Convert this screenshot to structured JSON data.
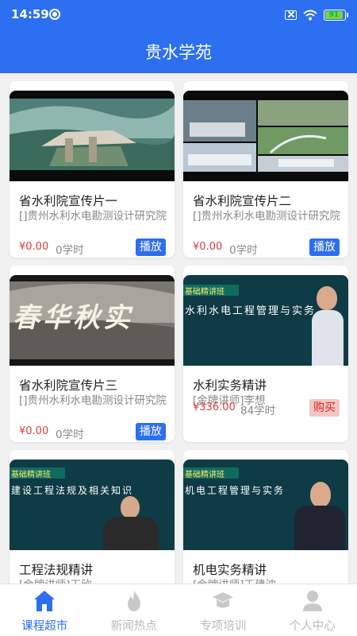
{
  "status": {
    "time": "14:59",
    "battery": "91"
  },
  "header": {
    "title": "贵水学苑"
  },
  "courses": [
    {
      "title": "省水利院宣传片一",
      "org": "[]贵州水利水电勘测设计研究院",
      "price": "¥0.00",
      "hours": "0学时",
      "action": "播放",
      "action_type": "play"
    },
    {
      "title": "省水利院宣传片二",
      "org": "[]贵州水利水电勘测设计研究院",
      "price": "¥0.00",
      "hours": "0学时",
      "action": "播放",
      "action_type": "play"
    },
    {
      "title": "省水利院宣传片三",
      "org": "[]贵州水利水电勘测设计研究院",
      "price": "¥0.00",
      "hours": "0学时",
      "action": "播放",
      "action_type": "play",
      "thumb_text": "春华秋实"
    },
    {
      "title": "水利实务精讲",
      "org": "[金牌讲师]李想",
      "price": "¥336.00",
      "hours": "84学时",
      "action": "购买",
      "action_type": "buy",
      "thumb_tag": "基础精讲班",
      "thumb_text": "水利水电工程管理与实务"
    },
    {
      "title": "工程法规精讲",
      "org": "[金牌讲师]王欣",
      "thumb_tag": "基础精讲班",
      "thumb_text": "建设工程法规及相关知识"
    },
    {
      "title": "机电实务精讲",
      "org": "[金牌讲师]王建波",
      "thumb_tag": "基础精讲班",
      "thumb_text": "机电工程管理与实务"
    }
  ],
  "nav": [
    {
      "label": "课程超市",
      "icon": "home-icon",
      "active": true
    },
    {
      "label": "新闻热点",
      "icon": "fire-icon",
      "active": false
    },
    {
      "label": "专项培训",
      "icon": "graduation-cap-icon",
      "active": false
    },
    {
      "label": "个人中心",
      "icon": "person-icon",
      "active": false
    }
  ],
  "colors": {
    "primary": "#2c6ff0",
    "price": "#e03b3b",
    "buy_bg": "#f3c6c6"
  }
}
